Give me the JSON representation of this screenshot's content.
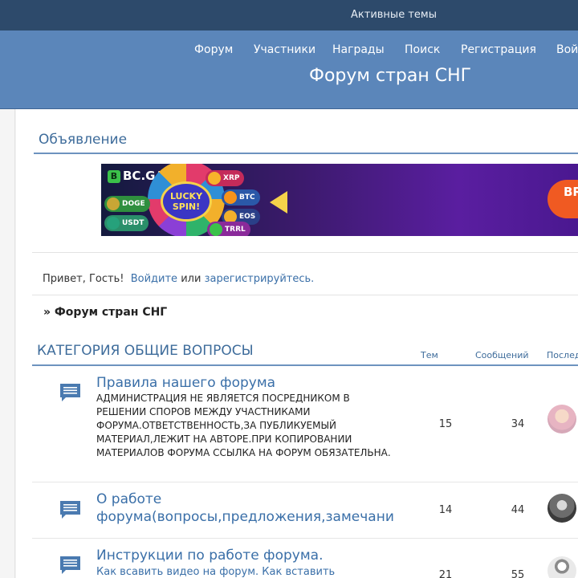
{
  "topbar": {
    "active_topics": "Активные темы"
  },
  "nav": {
    "items": [
      "Форум",
      "Участники",
      "Награды",
      "Поиск",
      "Регистрация",
      "Войти"
    ]
  },
  "site": {
    "title": "Форум стран СНГ"
  },
  "announcement": {
    "title": "Объявление",
    "banner": {
      "brand": "BC.GAME",
      "spin_label": "LUCKY SPIN!",
      "coins": [
        "XRP",
        "BTC",
        "DOGE",
        "EOS",
        "USDT",
        "TRRL"
      ]
    }
  },
  "welcome": {
    "greeting": "Привет, Гость!",
    "login": "Войдите",
    "or": "или",
    "register": "зарегистрируйтесь",
    "dot": "."
  },
  "breadcrumb": {
    "text": "» Форум стран СНГ"
  },
  "category": {
    "title": "КАТЕГОРИЯ ОБЩИЕ ВОПРОСЫ",
    "col_topics": "Тем",
    "col_posts": "Сообщений",
    "col_last": "Последнее"
  },
  "forums": [
    {
      "name": "Правила нашего форума",
      "description": "АДМИНИСТРАЦИЯ НЕ ЯВЛЯЕТСЯ ПОСРЕДНИКОМ В РЕШЕНИИ СПОРОВ МЕЖДУ УЧАСТНИКАМИ ФОРУМА.ОТВЕТСТВЕННОСТЬ,ЗА ПУБЛИКУЕМЫЙ МАТЕРИАЛ,ЛЕЖИТ НА АВТОРЕ.ПРИ КОПИРОВАНИИ МАТЕРИАЛОВ ФОРУМА ССЫЛКА НА ФОРУМ ОБЯЗАТЕЛЬНА.",
      "topics": "15",
      "posts": "34"
    },
    {
      "name": "О работе форума(вопросы,предложения,замечани",
      "description": "",
      "topics": "14",
      "posts": "44"
    },
    {
      "name": "Инструкции по работе форума.",
      "description": "Как всавить видео на форум. Как вставить",
      "topics": "21",
      "posts": "55"
    }
  ],
  "colors": {
    "topbar": "#2d4a6b",
    "header": "#5b86ba",
    "link": "#3a6fa8",
    "accent_line": "#6d93bf"
  }
}
